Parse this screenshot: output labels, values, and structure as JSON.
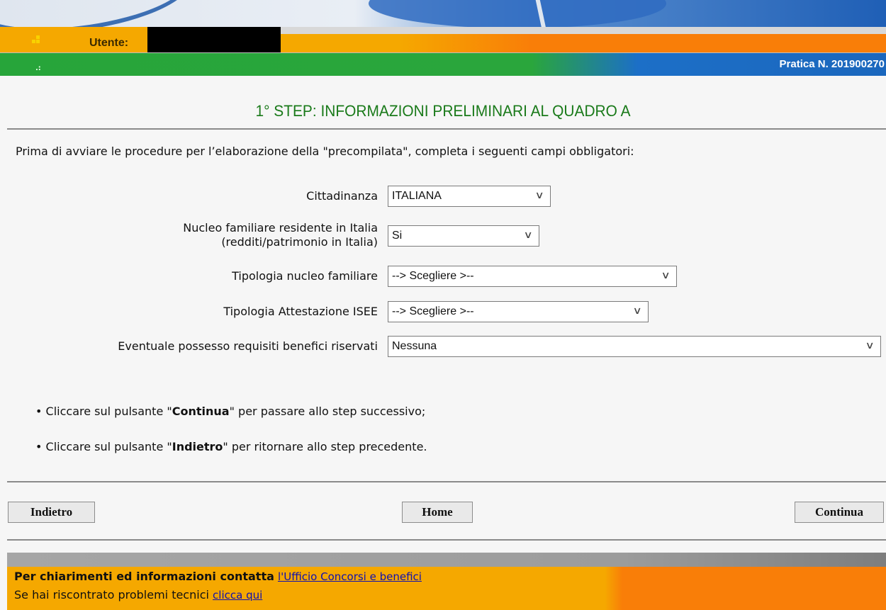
{
  "header": {
    "user_label": "Utente:",
    "pratica_label": "Pratica N. 201900270"
  },
  "page": {
    "title": "1° STEP: INFORMAZIONI PRELIMINARI AL QUADRO A",
    "intro": "Prima di avviare le procedure per l’elaborazione della \"precompilata\", completa i seguenti campi obbligatori:"
  },
  "form": {
    "cittadinanza": {
      "label": "Cittadinanza",
      "value": "ITALIANA"
    },
    "nucleo_residente": {
      "label_line1": "Nucleo familiare residente in Italia",
      "label_line2": "(redditi/patrimonio in Italia)",
      "value": "Si"
    },
    "tipologia_nucleo": {
      "label": "Tipologia nucleo familiare",
      "value": "--> Scegliere >--"
    },
    "tipologia_isee": {
      "label": "Tipologia Attestazione ISEE",
      "value": "--> Scegliere >--"
    },
    "requisiti": {
      "label": "Eventuale possesso requisiti benefici riservati",
      "value": "Nessuna"
    }
  },
  "instructions": [
    {
      "bullet": "•",
      "pre": "Cliccare sul pulsante ",
      "q_open": "\"",
      "bold": "Continua",
      "q_close": "\"",
      "post": " per passare allo step successivo;"
    },
    {
      "bullet": "•",
      "pre": "Cliccare sul pulsante ",
      "q_open": "\"",
      "bold": "Indietro",
      "q_close": "\"",
      "post": " per ritornare allo step precedente."
    }
  ],
  "buttons": {
    "back": "Indietro",
    "home": "Home",
    "next": "Continua"
  },
  "footer": {
    "line1_text": "Per chiarimenti ed informazioni contatta",
    "line1_link": "l'Ufficio Concorsi e benefici",
    "line2_text": "Se hai riscontrato problemi tecnici",
    "line2_link": "clicca qui"
  },
  "colors": {
    "title_green": "#1a7a1a",
    "orange": "#f5a800",
    "deep_orange": "#f97e08",
    "green_bar": "#27a53a",
    "link": "#1010b0"
  }
}
